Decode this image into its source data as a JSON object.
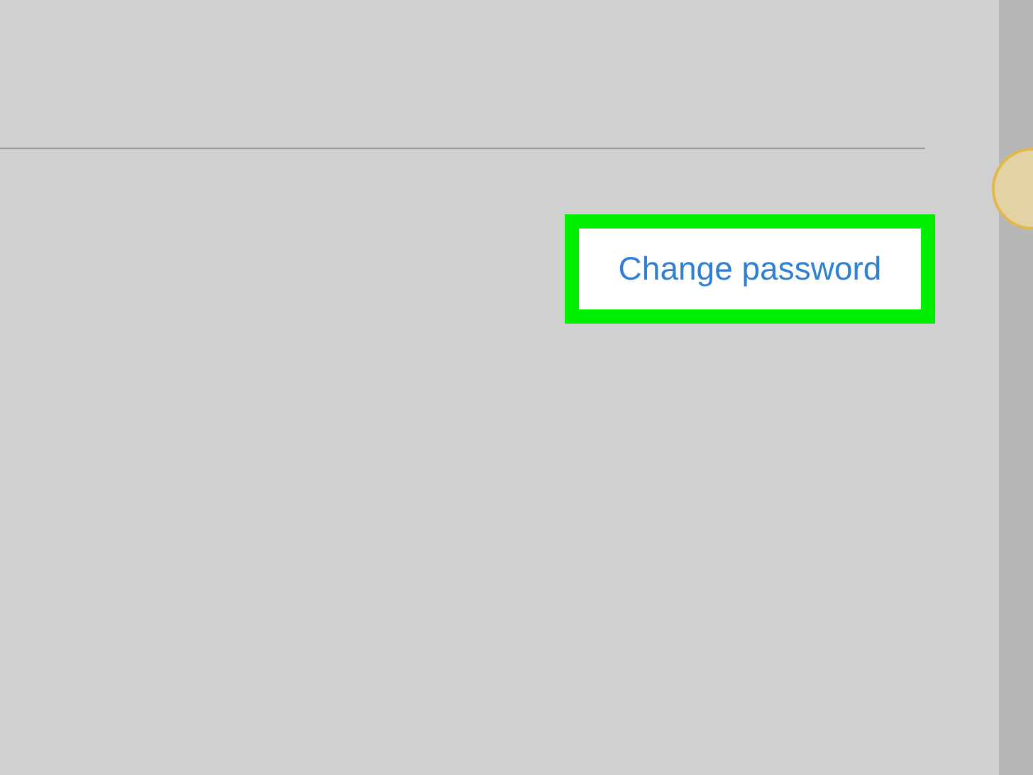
{
  "link": {
    "label": "Change password",
    "highlighted": true
  }
}
